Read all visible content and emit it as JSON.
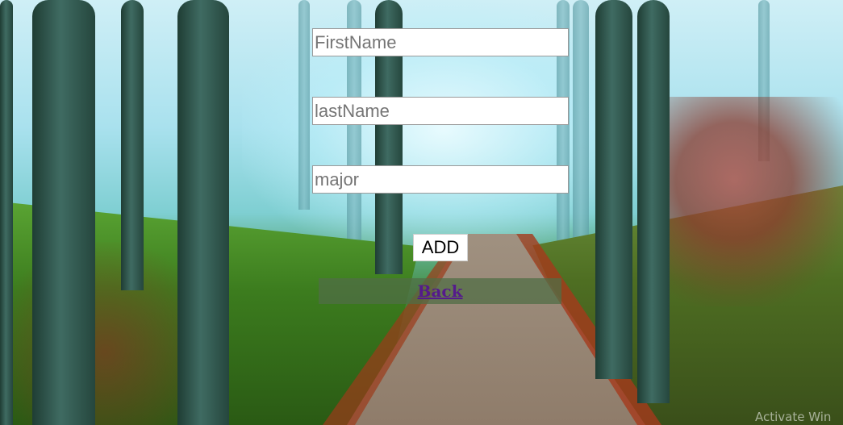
{
  "form": {
    "first_name": {
      "placeholder": "FirstName",
      "value": ""
    },
    "last_name": {
      "placeholder": "lastName",
      "value": ""
    },
    "major": {
      "placeholder": "major",
      "value": ""
    }
  },
  "actions": {
    "add_label": "ADD",
    "back_label": "Back"
  },
  "system": {
    "activation_watermark": "Activate Win"
  },
  "colors": {
    "link": "#551a8b",
    "back_bar": "#506e46"
  }
}
